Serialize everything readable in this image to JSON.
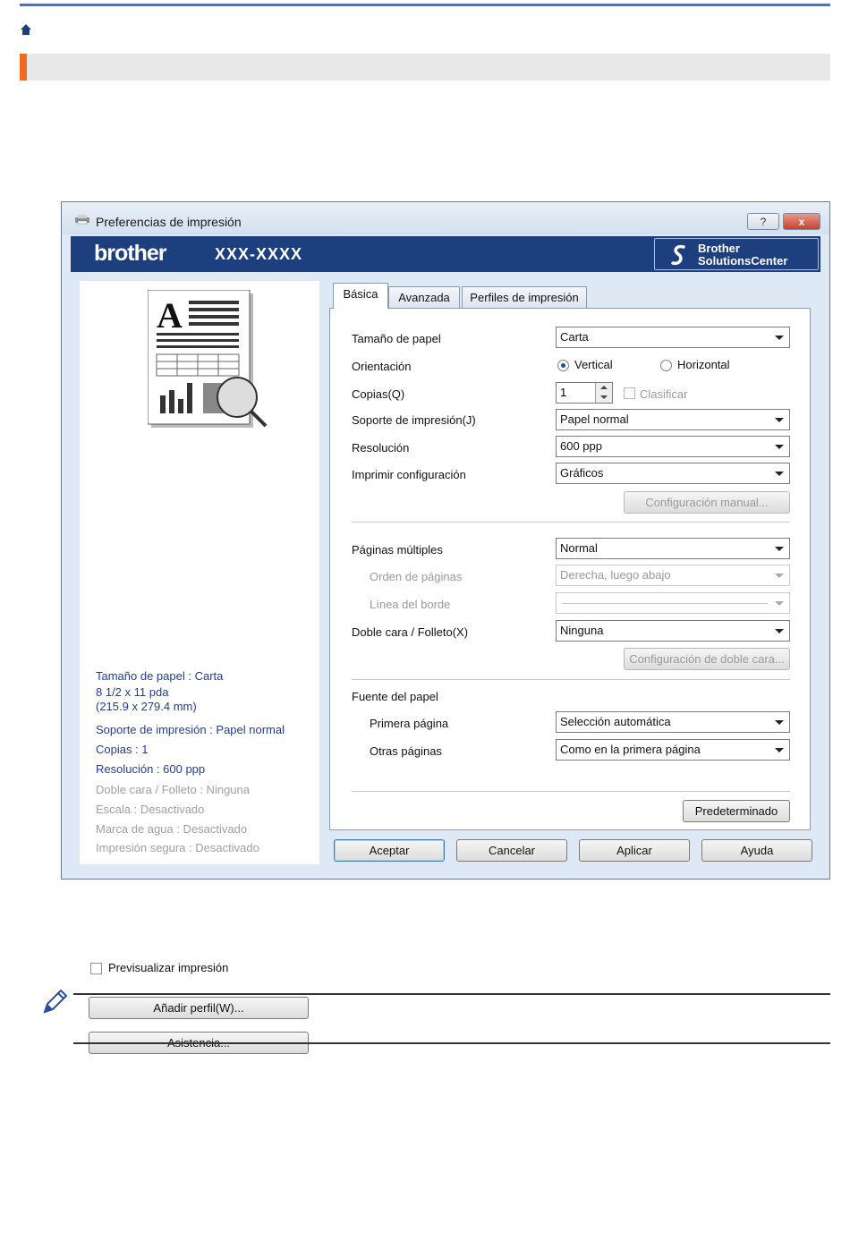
{
  "window": {
    "title": "Preferencias de impresión",
    "help_btn": "?",
    "close_btn": "x"
  },
  "brand": {
    "logo": "brother",
    "model": "XXX-XXXX",
    "solutions_line1": "Brother",
    "solutions_line2": "SolutionsCenter"
  },
  "summary": {
    "paper_size": "Tamaño de papel : Carta",
    "paper_dims1": "8 1/2 x 11 pda",
    "paper_dims2": "(215.9 x 279.4 mm)",
    "media": "Soporte de impresión : Papel normal",
    "copies": "Copias : 1",
    "resolution": "Resolución : 600 ppp",
    "duplex": "Doble cara / Folleto : Ninguna",
    "scale": "Escala : Desactivado",
    "watermark": "Marca de agua : Desactivado",
    "secure": "Impresión segura : Desactivado",
    "preview_label": "Previsualizar impresión",
    "add_profile_btn": "Añadir perfil(W)...",
    "support_btn": "Asistencia..."
  },
  "tabs": [
    "Básica",
    "Avanzada",
    "Perfiles de impresión"
  ],
  "basic": {
    "paper_size_label": "Tamaño de papel",
    "paper_size_value": "Carta",
    "orientation_label": "Orientación",
    "orientation_vertical": "Vertical",
    "orientation_horizontal": "Horizontal",
    "copies_label": "Copias(Q)",
    "copies_value": "1",
    "collate_label": "Clasificar",
    "media_label": "Soporte de impresión(J)",
    "media_value": "Papel normal",
    "resolution_label": "Resolución",
    "resolution_value": "600 ppp",
    "print_settings_label": "Imprimir configuración",
    "print_settings_value": "Gráficos",
    "manual_settings_btn": "Configuración manual...",
    "multiple_pages_label": "Páginas múltiples",
    "multiple_pages_value": "Normal",
    "page_order_label": "Orden de páginas",
    "page_order_value": "Derecha, luego abajo",
    "border_line_label": "Línea del borde",
    "duplex_label": "Doble cara / Folleto(X)",
    "duplex_value": "Ninguna",
    "duplex_settings_btn": "Configuración de doble cara...",
    "paper_source_label": "Fuente del papel",
    "first_page_label": "Primera página",
    "first_page_value": "Selección automática",
    "other_pages_label": "Otras páginas",
    "other_pages_value": "Como en la primera página",
    "default_btn": "Predeterminado"
  },
  "footer": {
    "ok": "Aceptar",
    "cancel": "Cancelar",
    "apply": "Aplicar",
    "help": "Ayuda"
  },
  "colors": {
    "accent": "#f26a21",
    "brand": "#1d3f7d",
    "summary_text": "#1f3e99"
  }
}
